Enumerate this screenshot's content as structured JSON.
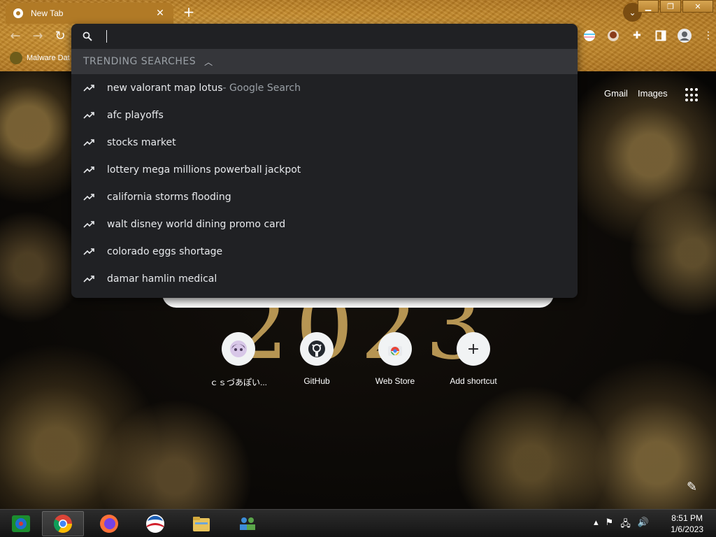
{
  "browser": {
    "tab_title": "New Tab",
    "close_glyph": "✕",
    "newtab_glyph": "+",
    "bookmark_label": "Malware Dat",
    "window_controls": {
      "minimize": "▁",
      "restore": "❐",
      "close": "✕"
    },
    "theme_color": "#c48a2c"
  },
  "omnibox": {
    "value": "",
    "header": "TRENDING SEARCHES",
    "suggestions": [
      {
        "text": "new valorant map lotus",
        "suffix": " - Google Search"
      },
      {
        "text": "afc playoffs",
        "suffix": ""
      },
      {
        "text": "stocks market",
        "suffix": ""
      },
      {
        "text": "lottery mega millions powerball jackpot",
        "suffix": ""
      },
      {
        "text": "california storms flooding",
        "suffix": ""
      },
      {
        "text": "walt disney world dining promo card",
        "suffix": ""
      },
      {
        "text": "colorado eggs shortage",
        "suffix": ""
      },
      {
        "text": "damar hamlin medical",
        "suffix": ""
      }
    ]
  },
  "ntp": {
    "links": {
      "gmail": "Gmail",
      "images": "Images"
    },
    "year_art": "2023",
    "shortcuts": [
      {
        "label": "ｃｓづあぽい...",
        "icon": "avatar-icon"
      },
      {
        "label": "GitHub",
        "icon": "github-icon"
      },
      {
        "label": "Web Store",
        "icon": "web-store-icon"
      },
      {
        "label": "Add shortcut",
        "icon": "plus-icon",
        "glyph": "+"
      }
    ]
  },
  "taskbar": {
    "time": "8:51 PM",
    "date": "1/6/2023",
    "apps": [
      "remote-desktop-icon",
      "chrome-icon",
      "firefox-icon",
      "obama-logo-icon",
      "file-explorer-icon",
      "network-users-icon"
    ]
  }
}
